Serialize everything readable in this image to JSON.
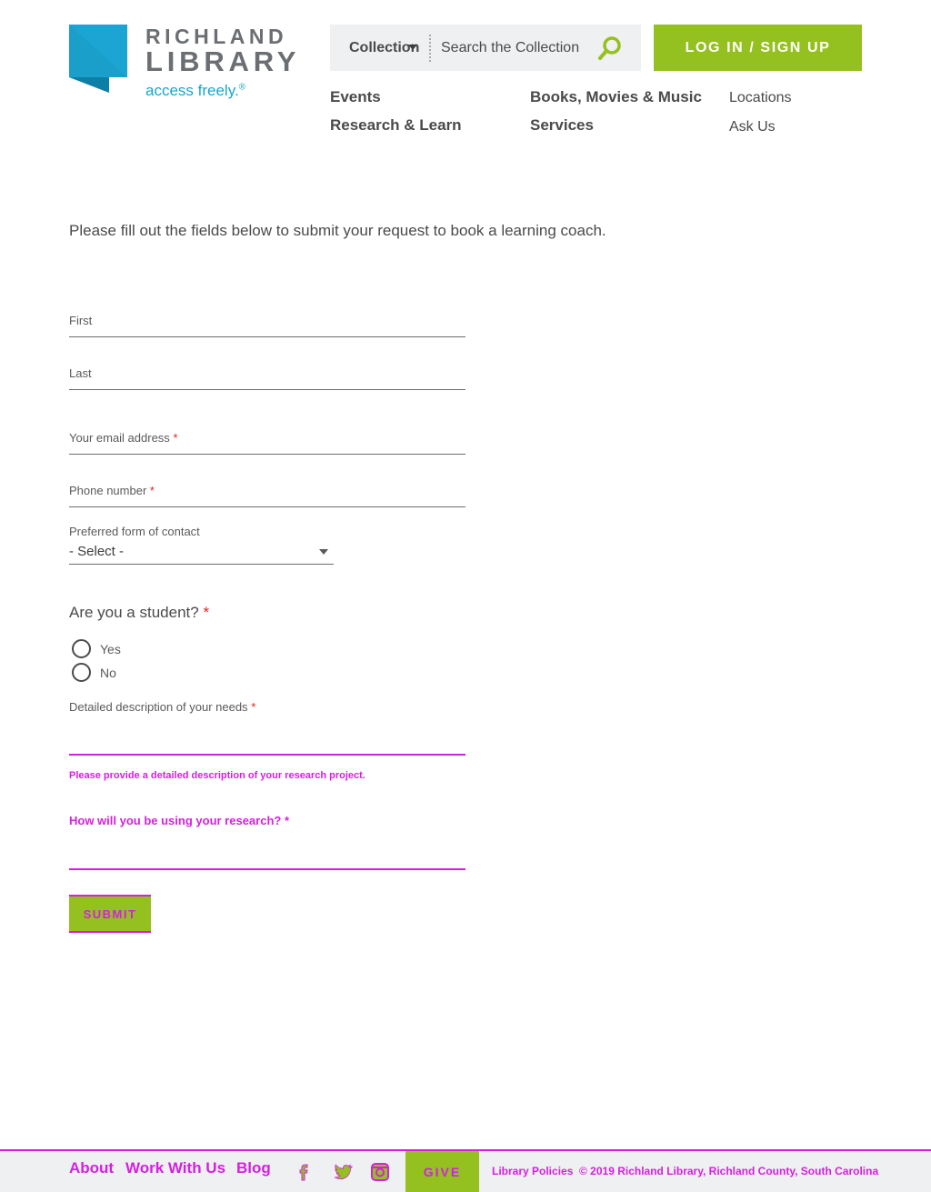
{
  "header": {
    "logo_line1": "RICHLAND",
    "logo_line2": "LIBRARY",
    "logo_tagline": "access freely.",
    "logo_registered": "®",
    "search_scope": "Collection",
    "search_placeholder": "Search the Collection",
    "login_label": "LOG IN / SIGN UP"
  },
  "nav": {
    "events": "Events",
    "books": "Books, Movies & Music",
    "locations": "Locations",
    "research": "Research & Learn",
    "services": "Services",
    "ask": "Ask Us"
  },
  "form": {
    "intro": "Please fill out the fields below to submit your request to book a learning coach.",
    "first_label": "First",
    "last_label": "Last",
    "email_label": "Your email address",
    "phone_label": "Phone number",
    "required_mark": "*",
    "contact_label": "Preferred form of contact",
    "contact_value": "- Select -",
    "student_question": "Are you a student?",
    "radio_options": [
      "Yes",
      "No"
    ],
    "needs_label": "Detailed description of your needs",
    "needs_help": "Please provide a detailed description of your research project.",
    "usage_label": "How will you be using your research?",
    "submit_label": "SUBMIT"
  },
  "footer": {
    "about": "About",
    "work": "Work With Us",
    "blog": "Blog",
    "give": "GIVE",
    "policies": "Library Policies",
    "copyright": "© 2019 Richland Library, Richland County, South Carolina"
  },
  "colors": {
    "brand_green": "#94c11f",
    "brand_teal": "#17a7c9",
    "required_red": "#e2231a",
    "highlight_magenta": "#d61fe0"
  },
  "icons": {
    "search": "search-icon",
    "facebook": "facebook-icon",
    "twitter": "twitter-icon",
    "instagram": "instagram-icon"
  }
}
